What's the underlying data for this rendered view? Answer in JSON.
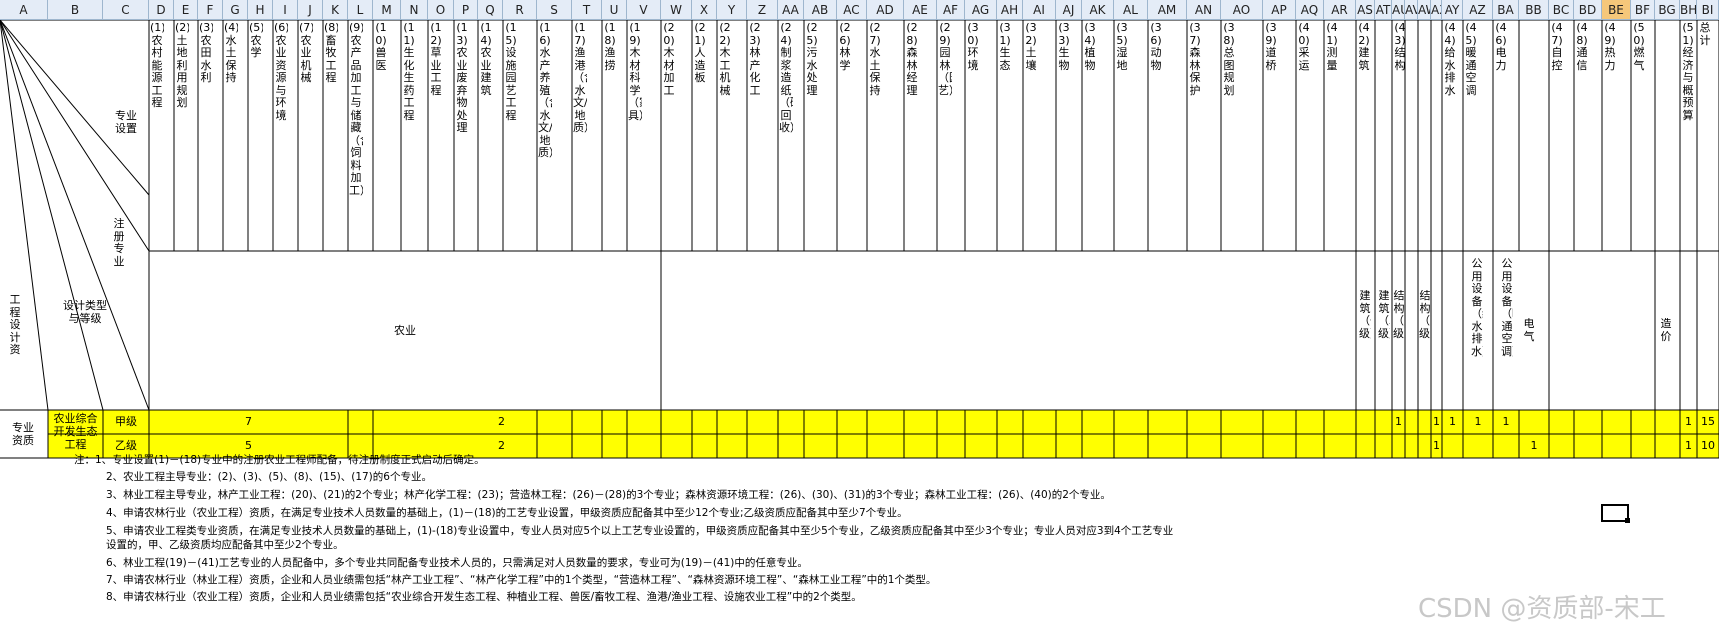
{
  "columns": [
    "A",
    "B",
    "C",
    "D",
    "E",
    "F",
    "G",
    "H",
    "I",
    "J",
    "K",
    "L",
    "M",
    "N",
    "O",
    "P",
    "Q",
    "R",
    "S",
    "T",
    "U",
    "V",
    "W",
    "X",
    "Y",
    "Z",
    "AA",
    "AB",
    "AC",
    "AD",
    "AE",
    "AF",
    "AG",
    "AH",
    "AI",
    "AJ",
    "AK",
    "AL",
    "AM",
    "AN",
    "AO",
    "AP",
    "AQ",
    "AR",
    "AS",
    "AT",
    "AU",
    "AV",
    "AW",
    "AX",
    "AY",
    "AZ",
    "BA",
    "BB",
    "BC",
    "BD",
    "BE",
    "BF",
    "BG",
    "BH",
    "BI"
  ],
  "selected_column": "BE",
  "corner": {
    "specialty_setting": "专业设置",
    "registered_specialty": "注册专业",
    "design_type_grade": "设计类型与等级",
    "engineering_qualification": "工程设计资"
  },
  "specialties": [
    "(1)农村能源工程",
    "(2)土地利用规划",
    "(3)农田水利",
    "(4)水土保持",
    "(5)农学",
    "(6)农业资源与环境",
    "(7)农业机械",
    "(8)畜牧工程",
    "(9)农产品加工与储藏（含饲料加工）",
    "(10)兽医",
    "(11)生化生药工程",
    "(12)草业工程",
    "(13)农业废弃物处理",
    "(14)农业建筑",
    "(15)设施园艺工程",
    "(16)水产养殖（含水文/地质）",
    "(17)渔港（含水文/地质）",
    "(18)渔捞",
    "(19)木材科学（家具）",
    "(20)木材加工",
    "(21)人造板",
    "(22)木工机械",
    "(23)林产化工",
    "(24)制浆造纸（碱回收）",
    "(25)污水处理",
    "(26)林学",
    "(27)水土保持",
    "(28)森林经理",
    "(29)园林（园艺）",
    "(30)环境",
    "(31)生态",
    "(32)土壤",
    "(33)生物",
    "(34)植物",
    "(35)湿地",
    "(36)动物",
    "(37)森林保护",
    "(38)总图规划",
    "(39)道桥",
    "(40)采运",
    "(41)测量",
    "(42)建筑",
    "(43)结构",
    "(44)给水排水",
    "(45)暖通空调",
    "(46)电力",
    "(47)自控",
    "(48)通信",
    "(49)热力",
    "(50)燃气",
    "(51)经济与概预算",
    "总计"
  ],
  "registered": {
    "agriculture": "农业",
    "arch1": "建筑（一级）",
    "arch2": "建筑（二级）",
    "struct1": "结构（一级）",
    "struct2": "结构（二级）",
    "plumbing": "公用设备（给水排水）",
    "hvac": "公用设备（暖通空调）",
    "electric": "电气",
    "cost": "造价"
  },
  "rows": {
    "qualification_label": "专业资质",
    "category": "农业综合开发生态工程",
    "grade_a": "甲级",
    "grade_b": "乙级"
  },
  "grade_a_values": {
    "agri_left": "7",
    "agri_right": "2",
    "struct2": "1",
    "struct1_b": "1",
    "plumbing": "1",
    "hvac": "1",
    "electric": "1",
    "cost": "1",
    "total": "15"
  },
  "grade_b_values": {
    "agri_left": "5",
    "agri_right": "2",
    "struct1_b": "1",
    "self_ctrl": "1",
    "cost": "1",
    "total": "10"
  },
  "notes": [
    "注：1、专业设置(1)－(18)专业中的注册农业工程师配备，待注册制度正式启动后确定。",
    "2、农业工程主导专业：(2)、(3)、(5)、(8)、(15)、(17)的6个专业。",
    "3、林业工程主导专业，林产工业工程：(20)、(21)的2个专业；林产化学工程：(23)；营造林工程：(26)－(28)的3个专业；森林资源环境工程：(26)、(30)、(31)的3个专业；森林工业工程：(26)、(40)的2个专业。",
    "4、申请农林行业（农业工程）资质，在满足专业技术人员数量的基础上，(1)－(18)的工艺专业设置，甲级资质应配备其中至少12个专业;乙级资质应配备其中至少7个专业。",
    "5、申请农业工程类专业资质，在满足专业技术人员数量的基础上，(1)-(18)专业设置中，专业人员对应5个以上工艺专业设置的，甲级资质应配备其中至少5个专业，乙级资质应配备其中至少3个专业；专业人员对应3到4个工艺专业",
    "设置的，甲、乙级资质均应配备其中至少2个专业。",
    "6、林业工程(19)－(41)工艺专业的人员配备中，多个专业共同配备专业技术人员的，只需满足对人员数量的要求，专业可为(19)－(41)中的任意专业。",
    "7、申请农林行业（林业工程）资质，企业和人员业绩需包括“林产工业工程”、“林产化学工程”中的1个类型，“营造林工程”、“森林资源环境工程”、“森林工业工程”中的1个类型。",
    "8、申请农林行业（农业工程）资质，企业和人员业绩需包括“农业综合开发生态工程、种植业工程、兽医/畜牧工程、渔港/渔业工程、设施农业工程”中的2个类型。"
  ],
  "watermark": "CSDN @资质部-宋工",
  "colors": {
    "header_bg": "#e4ecf7",
    "selected_header": "#f5c77a",
    "yellow": "#ffff00",
    "grid": "#a6a6a6"
  }
}
